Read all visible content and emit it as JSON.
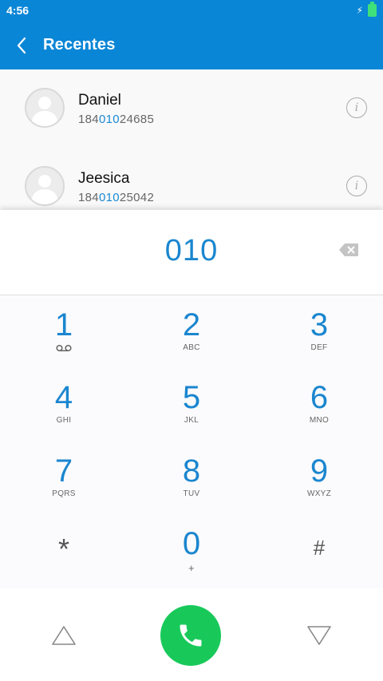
{
  "status_bar": {
    "time": "4:56"
  },
  "app_bar": {
    "title": "Recentes"
  },
  "contacts": [
    {
      "name": "Daniel",
      "number_prefix": "184",
      "number_match": "010",
      "number_suffix": "24685"
    },
    {
      "name": "Jeesica",
      "number_prefix": "184",
      "number_match": "010",
      "number_suffix": "25042"
    }
  ],
  "dialer": {
    "input_value": "010"
  },
  "keypad": [
    {
      "digit": "1",
      "sub": ""
    },
    {
      "digit": "2",
      "sub": "ABC"
    },
    {
      "digit": "3",
      "sub": "DEF"
    },
    {
      "digit": "4",
      "sub": "GHI"
    },
    {
      "digit": "5",
      "sub": "JKL"
    },
    {
      "digit": "6",
      "sub": "MNO"
    },
    {
      "digit": "7",
      "sub": "PQRS"
    },
    {
      "digit": "8",
      "sub": "TUV"
    },
    {
      "digit": "9",
      "sub": "WXYZ"
    },
    {
      "digit": "0",
      "sub": "+"
    }
  ],
  "keypad_symbols": {
    "star": "*",
    "hash": "#"
  },
  "icons": {
    "back": "chevron-left-icon",
    "info": "info-icon",
    "backspace": "backspace-icon",
    "voicemail": "voicemail-icon",
    "call": "phone-icon",
    "nav_up": "triangle-up-icon",
    "nav_down": "triangle-down-icon"
  },
  "colors": {
    "primary": "#0a86d6",
    "digit": "#1a86cf",
    "highlight": "#1a8ad4",
    "call": "#18c95a"
  }
}
